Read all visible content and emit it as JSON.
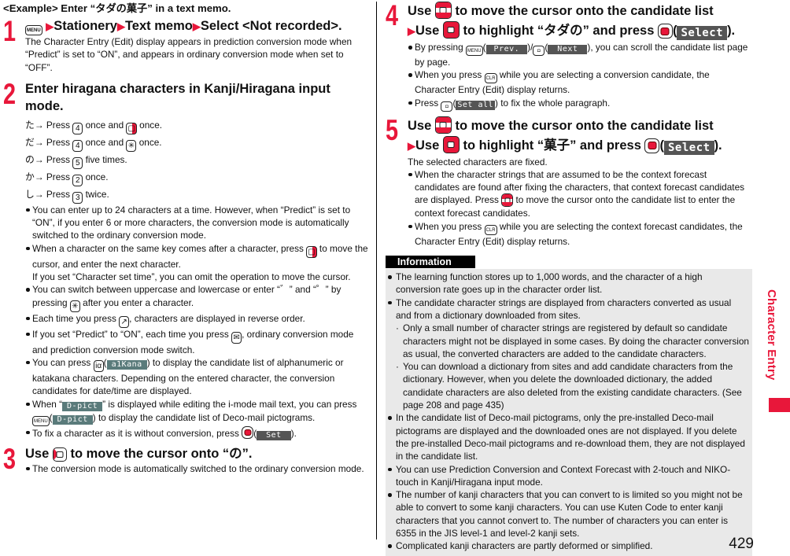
{
  "example_heading": "<Example> Enter “タダの菓子” in a text memo.",
  "steps": [
    {
      "num": "1",
      "title": {
        "key": "MENU",
        "parts": [
          "Stationery",
          "Text memo",
          "Select <Not recorded>."
        ]
      },
      "body": "The Character Entry (Edit) display appears in prediction conversion mode when “Predict” is set to “ON”, and appears in ordinary conversion mode when set to “OFF”."
    },
    {
      "num": "2",
      "title": "Enter hiragana characters in Kanji/Hiragana input mode.",
      "inputs": [
        {
          "kana": "た",
          "text_a": "Press",
          "key1": "4",
          "text_b": "once and",
          "key2_name": "right-key",
          "text_c": "once."
        },
        {
          "kana": "だ",
          "text_a": "Press",
          "key1": "4",
          "text_b": "once and",
          "key2": "✳",
          "text_c": "once."
        },
        {
          "kana": "の",
          "text_a": "Press",
          "key1": "5",
          "text_b": "five times."
        },
        {
          "kana": "か",
          "text_a": "Press",
          "key1": "2",
          "text_b": "once."
        },
        {
          "kana": "し",
          "text_a": "Press",
          "key1": "3",
          "text_b": "twice."
        }
      ],
      "bullets": {
        "b1": "You can enter up to 24 characters at a time. However, when “Predict” is set to “ON”, if you enter 6 or more characters, the conversion mode is automatically switched to the ordinary conversion mode.",
        "b2_a": "When a character on the same key comes after a character, press",
        "b2_b": "to move the cursor, and enter the next character.",
        "b2_c": "If you set “Character set time”, you can omit the operation to move the cursor.",
        "b3_a": "You can switch between uppercase and lowercase or enter “゛” and “゜” by pressing",
        "b3_b": "after you enter a character.",
        "b4_a": "Each time you press",
        "b4_b": ", characters are displayed in reverse order.",
        "b5_a": "If you set “Predict” to “ON”, each time you press",
        "b5_b": ", ordinary conversion mode and prediction conversion mode switch.",
        "b6_a": "You can press",
        "b6_soft": "a1Kana",
        "b6_b": ") to display the candidate list of alphanumeric or katakana characters. Depending on the entered character, the conversion candidates for date/time are displayed.",
        "b7_a": "When “",
        "b7_soft": "D-pict",
        "b7_b": "” is displayed while editing the i-mode mail text, you can press",
        "b7_c": ") to display the candidate list of Deco-mail pictograms.",
        "b8_a": "To fix a character as it is without conversion, press",
        "b8_soft": "Set",
        "b8_b": ")."
      }
    },
    {
      "num": "3",
      "title_a": "Use",
      "title_b": "to move the cursor onto “の”.",
      "bullets": [
        "The conversion mode is automatically switched to the ordinary conversion mode."
      ]
    },
    {
      "num": "4",
      "title_a": "Use",
      "title_b": "to move the cursor onto the candidate list",
      "title_c": "Use",
      "title_d": "to highlight “タダの” and press",
      "title_soft": "Select",
      "bullets": {
        "b1_a": "By pressing",
        "b1_soft1": "Prev.",
        "b1_soft2": "Next",
        "b1_b": "), you can scroll the candidate list page by page.",
        "b2_a": "When you press",
        "b2_key": "CLR",
        "b2_b": "while you are selecting a conversion candidate, the Character Entry (Edit) display returns.",
        "b3_a": "Press",
        "b3_soft": "Set all",
        "b3_b": ") to fix the whole paragraph."
      }
    },
    {
      "num": "5",
      "title_a": "Use",
      "title_b": "to move the cursor onto the candidate list",
      "title_c": "Use",
      "title_d": "to highlight “菓子” and press",
      "title_soft": "Select",
      "body": "The selected characters are fixed.",
      "bullets": {
        "b1_a": "When the character strings that are assumed to be the context forecast candidates are found after fixing the characters, that context forecast candidates are displayed. Press",
        "b1_b": "to move the cursor onto the candidate list to enter the context forecast candidates.",
        "b2_a": "When you press",
        "b2_key": "CLR",
        "b2_b": "while you are selecting the context forecast candidates, the Character Entry (Edit) display returns."
      }
    }
  ],
  "information": {
    "label": "Information",
    "items": [
      "The learning function stores up to 1,000 words, and the character of a high conversion rate goes up in the character order list.",
      "The candidate character strings are displayed from characters converted as usual and from a dictionary downloaded from sites.",
      "In the candidate list of Deco-mail pictograms, only the pre-installed Deco-mail pictograms are displayed and the downloaded ones are not displayed. If you delete the pre-installed Deco-mail pictograms and re-download them, they are not displayed in the candidate list.",
      "You can use Prediction Conversion and Context Forecast with 2-touch and NIKO-touch in Kanji/Hiragana input mode.",
      "The number of kanji characters that you can convert to is limited so you might not be able to convert to some kanji characters. You can use Kuten Code to enter kanji characters that you cannot convert to. The number of characters you can enter is 6355 in the JIS level-1 and level-2 kanji sets.",
      "Complicated kanji characters are partly deformed or simplified."
    ],
    "subitems": [
      "Only a small number of character strings are registered by default so candidate characters might not be displayed in some cases. By doing the character conversion as usual, the converted characters are added to the candidate characters.",
      "You can download a dictionary from sites and add candidate characters from the dictionary. However, when you delete the downloaded dictionary, the added candidate characters are also deleted from the existing candidate characters. (See page 208 and page 435)"
    ]
  },
  "side_tab": "Character Entry",
  "page_number": "429",
  "keys": {
    "menu": "MENU",
    "arrow": "▶",
    "star": "✳",
    "arrow_right": "→",
    "bullet_dot": "·"
  },
  "colors": {
    "accent": "#e8173a",
    "info_bg": "#e9e9e9",
    "softkey_bg": "#555555"
  }
}
